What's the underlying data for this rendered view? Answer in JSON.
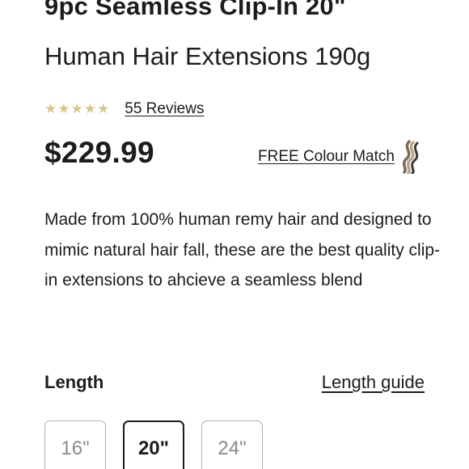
{
  "product": {
    "title_line1": "9pc Seamless Clip-In 20\"",
    "title_line2": "Human Hair Extensions 190g",
    "rating": {
      "stars": 5,
      "star_color": "#d8c68f",
      "reviews_label": "55 Reviews"
    },
    "price": "$229.99",
    "colour_match": {
      "label": "FREE Colour Match",
      "icon": "hair-swatch-icon"
    },
    "description": "Made from 100% human remy hair and designed to mimic natural hair fall, these are the best quality clip-in extensions to ahcieve a seamless blend"
  },
  "length": {
    "label": "Length",
    "guide_label": "Length guide",
    "options": [
      {
        "label": "16\"",
        "selected": false
      },
      {
        "label": "20\"",
        "selected": true
      },
      {
        "label": "24\"",
        "selected": false
      }
    ]
  }
}
